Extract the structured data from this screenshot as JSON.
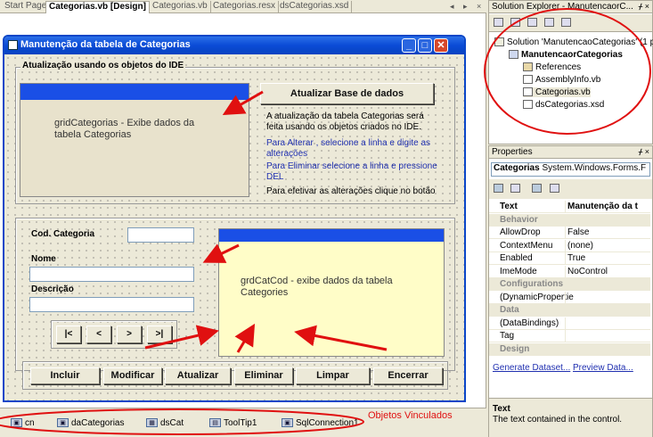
{
  "tabs": [
    "Start Page",
    "Categorias.vb [Design]",
    "Categorias.vb",
    "Categorias.resx",
    "dsCategorias.xsd"
  ],
  "tab_controls": "◂ ▸ ×",
  "form": {
    "title": "Manutenção da tabela de Categorias",
    "group1_title": "Atualização usando os objetos do IDE",
    "grid1_text": "gridCategorias - Exibe dados da tabela Categorias",
    "update_button": "Atualizar Base de dados",
    "info": [
      "A atualização da tabela Categorias será",
      "feita usando os objetos criados no IDE.",
      "Para Alterar , selecione a linha e digite as",
      "alterações",
      "Para Eliminar selecione a linha e pressione",
      "DEL",
      "Para efetivar as alterações clique no botão"
    ],
    "lbl_cod": "Cod. Categoria",
    "lbl_nome": "Nome",
    "lbl_desc": "Descrição",
    "nav": [
      "|<",
      "<",
      ">",
      ">|"
    ],
    "grid2_text": "grdCatCod - exibe dados da tabela Categories",
    "buttons": [
      "Incluir",
      "Modificar",
      "Atualizar",
      "Eliminar",
      "Limpar",
      "Encerrar"
    ]
  },
  "tray": {
    "components": [
      "cn",
      "daCategorias",
      "dsCat",
      "ToolTip1",
      "SqlConnection1"
    ],
    "annotation": "Objetos Vinculados"
  },
  "solution_explorer": {
    "title": "Solution Explorer - ManutencaorC...",
    "pin": "ᚋ ×",
    "items": [
      "Solution 'ManutencaoCategorias' (1 proj",
      "ManutencaorCategorias",
      "References",
      "AssemblyInfo.vb",
      "Categorias.vb",
      "dsCategorias.xsd"
    ]
  },
  "properties": {
    "title": "Properties",
    "pin": "ᚋ ×",
    "object": "Categorias",
    "object_type": "System.Windows.Forms.F",
    "rows": [
      {
        "name": "Text",
        "value": "Manutenção da t",
        "cat": false
      },
      {
        "name": "Behavior",
        "value": "",
        "cat": true
      },
      {
        "name": "AllowDrop",
        "value": "False",
        "cat": false
      },
      {
        "name": "ContextMenu",
        "value": "(none)",
        "cat": false
      },
      {
        "name": "Enabled",
        "value": "True",
        "cat": false
      },
      {
        "name": "ImeMode",
        "value": "NoControl",
        "cat": false
      },
      {
        "name": "Configurations",
        "value": "",
        "cat": true
      },
      {
        "name": "(DynamicPropertie",
        "value": "",
        "cat": false
      },
      {
        "name": "Data",
        "value": "",
        "cat": true
      },
      {
        "name": "(DataBindings)",
        "value": "",
        "cat": false
      },
      {
        "name": "Tag",
        "value": "",
        "cat": false
      },
      {
        "name": "Design",
        "value": "",
        "cat": true
      }
    ],
    "links": [
      "Generate Dataset...",
      "Preview Data..."
    ],
    "desc_title": "Text",
    "desc_text": "The text contained in the control."
  },
  "colors": {
    "annotation_red": "#e01010",
    "titlebar_blue": "#0a4bd6",
    "grid_header": "#1a4fe6"
  }
}
